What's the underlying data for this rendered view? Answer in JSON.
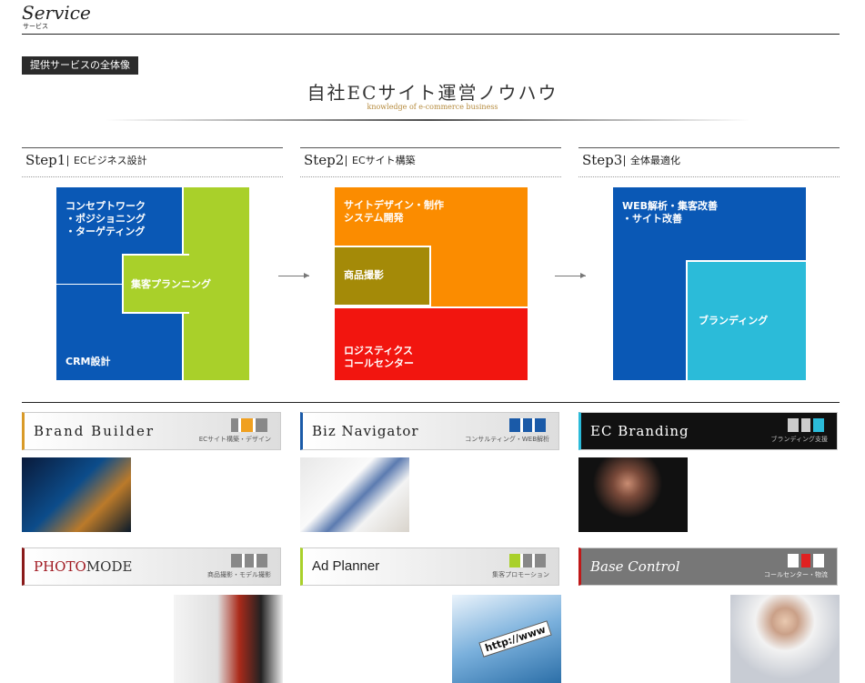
{
  "header": {
    "title": "Service",
    "subtitle": "サービス"
  },
  "badge": "提供サービスの全体像",
  "hero": {
    "title": "自社ECサイト運営ノウハウ",
    "subtitle": "knowledge of e-commerce business"
  },
  "steps": [
    {
      "num": "Step1",
      "desc": "ECビジネス設計"
    },
    {
      "num": "Step2",
      "desc": "ECサイト構築"
    },
    {
      "num": "Step3",
      "desc": "全体最適化"
    }
  ],
  "step1_blocks": {
    "concept": "コンセプトワーク\n・ポジショニング\n・ターゲティング",
    "plan": "集客プランニング",
    "crm": "CRM設計"
  },
  "step2_blocks": {
    "design": "サイトデザイン・制作\nシステム開発",
    "photo": "商品撮影",
    "logi": "ロジスティクス\nコールセンター"
  },
  "step3_blocks": {
    "web": "WEB解析・集客改善\n・サイト改善",
    "brand": "ブランディング"
  },
  "services": [
    {
      "name": "Brand Builder",
      "sub": "ECサイト構築・デザイン"
    },
    {
      "name": "Biz Navigator",
      "sub": "コンサルティング・WEB解析"
    },
    {
      "name": "EC Branding",
      "sub": "ブランディング支援"
    },
    {
      "name_a": "PHOTO",
      "name_b": "MODE",
      "sub": "商品撮影・モデル撮影"
    },
    {
      "name": "Ad Planner",
      "sub": "集客プロモーション"
    },
    {
      "name": "Base Control",
      "sub": "コールセンター・物流"
    }
  ],
  "thumb_text": "http://www",
  "colors": {
    "blue": "#0a58b5",
    "green": "#a9d02a",
    "orange": "#fb8c00",
    "olive": "#a48a08",
    "red": "#f2150f",
    "cyan": "#2bbbd9"
  }
}
